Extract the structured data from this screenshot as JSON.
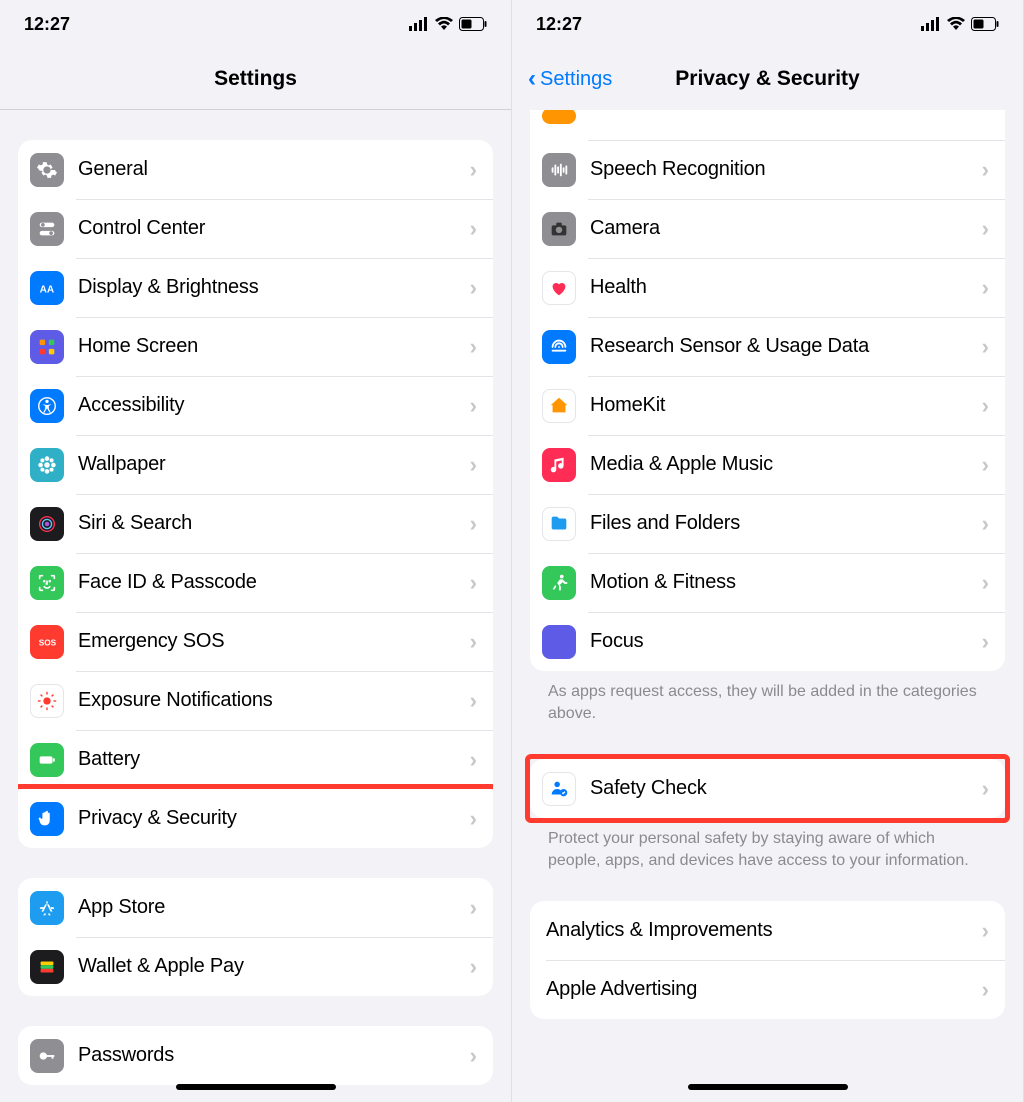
{
  "status": {
    "time": "12:27"
  },
  "left": {
    "title": "Settings",
    "rows": [
      {
        "label": "General"
      },
      {
        "label": "Control Center"
      },
      {
        "label": "Display & Brightness"
      },
      {
        "label": "Home Screen"
      },
      {
        "label": "Accessibility"
      },
      {
        "label": "Wallpaper"
      },
      {
        "label": "Siri & Search"
      },
      {
        "label": "Face ID & Passcode"
      },
      {
        "label": "Emergency SOS"
      },
      {
        "label": "Exposure Notifications"
      },
      {
        "label": "Battery"
      },
      {
        "label": "Privacy & Security"
      }
    ],
    "rows2": [
      {
        "label": "App Store"
      },
      {
        "label": "Wallet & Apple Pay"
      }
    ],
    "rows3": [
      {
        "label": "Passwords"
      }
    ]
  },
  "right": {
    "back": "Settings",
    "title": "Privacy & Security",
    "rows": [
      {
        "label": "Speech Recognition"
      },
      {
        "label": "Camera"
      },
      {
        "label": "Health"
      },
      {
        "label": "Research Sensor & Usage Data"
      },
      {
        "label": "HomeKit"
      },
      {
        "label": "Media & Apple Music"
      },
      {
        "label": "Files and Folders"
      },
      {
        "label": "Motion & Fitness"
      },
      {
        "label": "Focus"
      }
    ],
    "footer1": "As apps request access, they will be added in the categories above.",
    "safety": {
      "label": "Safety Check"
    },
    "footer2": "Protect your personal safety by staying aware of which people, apps, and devices have access to your information.",
    "rows2": [
      {
        "label": "Analytics & Improvements"
      },
      {
        "label": "Apple Advertising"
      }
    ]
  }
}
